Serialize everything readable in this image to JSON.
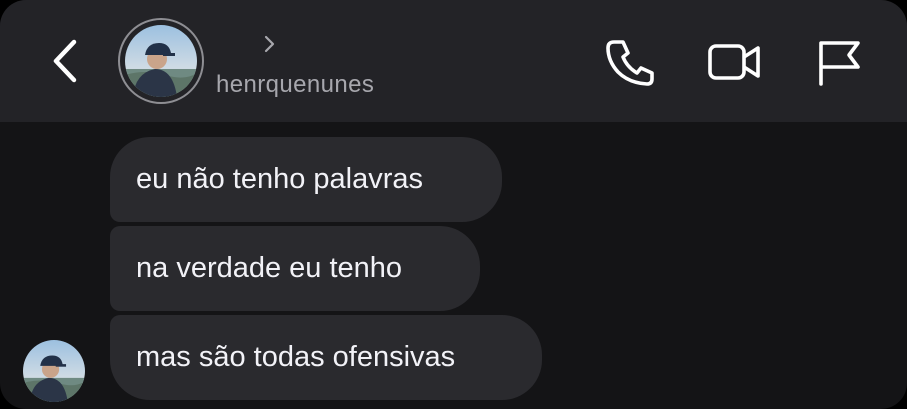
{
  "header": {
    "username": "henrquenunes",
    "back_icon": "chevron-left-icon",
    "profile_chevron_icon": "chevron-right-icon",
    "actions": [
      {
        "name": "call-button",
        "icon": "phone-icon"
      },
      {
        "name": "video-call-button",
        "icon": "video-camera-icon"
      },
      {
        "name": "report-button",
        "icon": "flag-icon"
      }
    ]
  },
  "messages": [
    {
      "text": "eu não tenho palavras"
    },
    {
      "text": "na verdade eu tenho"
    },
    {
      "text": "mas são todas ofensivas"
    }
  ],
  "colors": {
    "background": "#141416",
    "header": "#232327",
    "bubble": "#2a2a2e",
    "text": "#f2f2f7",
    "username": "#a7a7ad",
    "icons": "#ffffff"
  }
}
